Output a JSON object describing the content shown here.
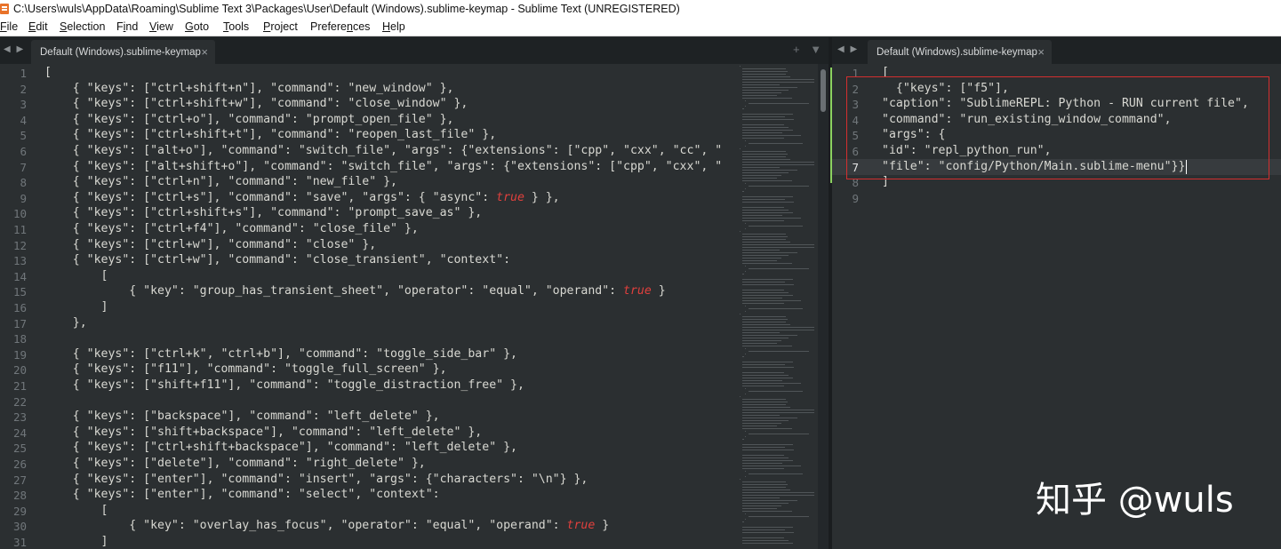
{
  "window": {
    "title": "C:\\Users\\wuls\\AppData\\Roaming\\Sublime Text 3\\Packages\\User\\Default (Windows).sublime-keymap - Sublime Text (UNREGISTERED)"
  },
  "menu": [
    {
      "mn": "F",
      "rest": "ile"
    },
    {
      "mn": "E",
      "rest": "dit"
    },
    {
      "mn": "S",
      "rest": "election"
    },
    {
      "pre": "F",
      "mn": "i",
      "rest": "nd"
    },
    {
      "mn": "V",
      "rest": "iew"
    },
    {
      "mn": "G",
      "rest": "oto"
    },
    {
      "mn": "T",
      "rest": "ools"
    },
    {
      "mn": "P",
      "rest": "roject"
    },
    {
      "pre": "Prefere",
      "mn": "n",
      "rest": "ces"
    },
    {
      "mn": "H",
      "rest": "elp"
    }
  ],
  "left_pane": {
    "tab_label": "Default (Windows).sublime-keymap",
    "tab_close": "×",
    "nav": "◀ ▶",
    "tools": "+ ▼",
    "lines": [
      "[",
      "    { \"keys\": [\"ctrl+shift+n\"], \"command\": \"new_window\" },",
      "    { \"keys\": [\"ctrl+shift+w\"], \"command\": \"close_window\" },",
      "    { \"keys\": [\"ctrl+o\"], \"command\": \"prompt_open_file\" },",
      "    { \"keys\": [\"ctrl+shift+t\"], \"command\": \"reopen_last_file\" },",
      "    { \"keys\": [\"alt+o\"], \"command\": \"switch_file\", \"args\": {\"extensions\": [\"cpp\", \"cxx\", \"cc\", \"",
      "    { \"keys\": [\"alt+shift+o\"], \"command\": \"switch_file\", \"args\": {\"extensions\": [\"cpp\", \"cxx\", \"",
      "    { \"keys\": [\"ctrl+n\"], \"command\": \"new_file\" },",
      "    { \"keys\": [\"ctrl+s\"], \"command\": \"save\", \"args\": { \"async\": |true| } },",
      "    { \"keys\": [\"ctrl+shift+s\"], \"command\": \"prompt_save_as\" },",
      "    { \"keys\": [\"ctrl+f4\"], \"command\": \"close_file\" },",
      "    { \"keys\": [\"ctrl+w\"], \"command\": \"close\" },",
      "    { \"keys\": [\"ctrl+w\"], \"command\": \"close_transient\", \"context\":",
      "        [",
      "            { \"key\": \"group_has_transient_sheet\", \"operator\": \"equal\", \"operand\": |true| }",
      "        ]",
      "    },",
      "",
      "    { \"keys\": [\"ctrl+k\", \"ctrl+b\"], \"command\": \"toggle_side_bar\" },",
      "    { \"keys\": [\"f11\"], \"command\": \"toggle_full_screen\" },",
      "    { \"keys\": [\"shift+f11\"], \"command\": \"toggle_distraction_free\" },",
      "",
      "    { \"keys\": [\"backspace\"], \"command\": \"left_delete\" },",
      "    { \"keys\": [\"shift+backspace\"], \"command\": \"left_delete\" },",
      "    { \"keys\": [\"ctrl+shift+backspace\"], \"command\": \"left_delete\" },",
      "    { \"keys\": [\"delete\"], \"command\": \"right_delete\" },",
      "    { \"keys\": [\"enter\"], \"command\": \"insert\", \"args\": {\"characters\": \"\\n\"} },",
      "    { \"keys\": [\"enter\"], \"command\": \"select\", \"context\":",
      "        [",
      "            { \"key\": \"overlay_has_focus\", \"operator\": \"equal\", \"operand\": |true| }",
      "        ]"
    ]
  },
  "right_pane": {
    "tab_label": "Default (Windows).sublime-keymap",
    "tab_close": "×",
    "nav": "◀ ▶",
    "active_line": 7,
    "lines": [
      "[",
      "  {\"keys\": [\"f5\"],",
      "\"caption\": \"SublimeREPL: Python - RUN current file\",",
      "\"command\": \"run_existing_window_command\",",
      "\"args\": {",
      "\"id\": \"repl_python_run\",",
      "\"file\": \"config/Python/Main.sublime-menu\"}}",
      "]",
      ""
    ]
  },
  "colors": {
    "literal": "#e0403d",
    "highlight_border": "#d32f2f",
    "modified_marker": "#8bd15f"
  },
  "watermark": "知乎 @wuls"
}
